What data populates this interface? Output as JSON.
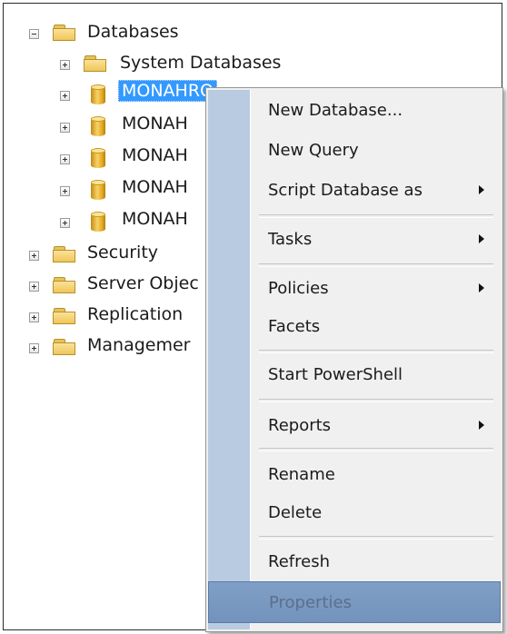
{
  "tree": {
    "items": [
      {
        "label": "Databases",
        "expander": "minus",
        "icon": "folder-icon"
      },
      {
        "label": "System Databases",
        "expander": "plus",
        "icon": "folder-icon"
      },
      {
        "label": "MONAHRQ",
        "expander": "plus",
        "icon": "database-icon",
        "selected": true
      },
      {
        "label": "MONAH",
        "expander": "plus",
        "icon": "database-icon"
      },
      {
        "label": "MONAH",
        "expander": "plus",
        "icon": "database-icon"
      },
      {
        "label": "MONAH",
        "expander": "plus",
        "icon": "database-icon"
      },
      {
        "label": "MONAH",
        "expander": "plus",
        "icon": "database-icon"
      },
      {
        "label": "Security",
        "expander": "plus",
        "icon": "folder-icon"
      },
      {
        "label": "Server Objec",
        "expander": "plus",
        "icon": "folder-icon"
      },
      {
        "label": "Replication",
        "expander": "plus",
        "icon": "folder-icon"
      },
      {
        "label": "Managemer",
        "expander": "plus",
        "icon": "folder-icon"
      }
    ]
  },
  "context_menu": {
    "items": [
      {
        "label": "New Database...",
        "submenu": false
      },
      {
        "label": "New Query",
        "submenu": false
      },
      {
        "label": "Script Database as",
        "submenu": true
      },
      {
        "label": "Tasks",
        "submenu": true
      },
      {
        "label": "Policies",
        "submenu": true
      },
      {
        "label": "Facets",
        "submenu": false
      },
      {
        "label": "Start PowerShell",
        "submenu": false
      },
      {
        "label": "Reports",
        "submenu": true
      },
      {
        "label": "Rename",
        "submenu": false
      },
      {
        "label": "Delete",
        "submenu": false
      },
      {
        "label": "Refresh",
        "submenu": false
      },
      {
        "label": "Properties",
        "submenu": false,
        "highlighted": true
      }
    ]
  },
  "colors": {
    "selection": "#3399ff",
    "menu_background": "#f0f0f0",
    "menu_gutter": "#b9cbe0",
    "menu_highlight": "#7f9fc6"
  }
}
